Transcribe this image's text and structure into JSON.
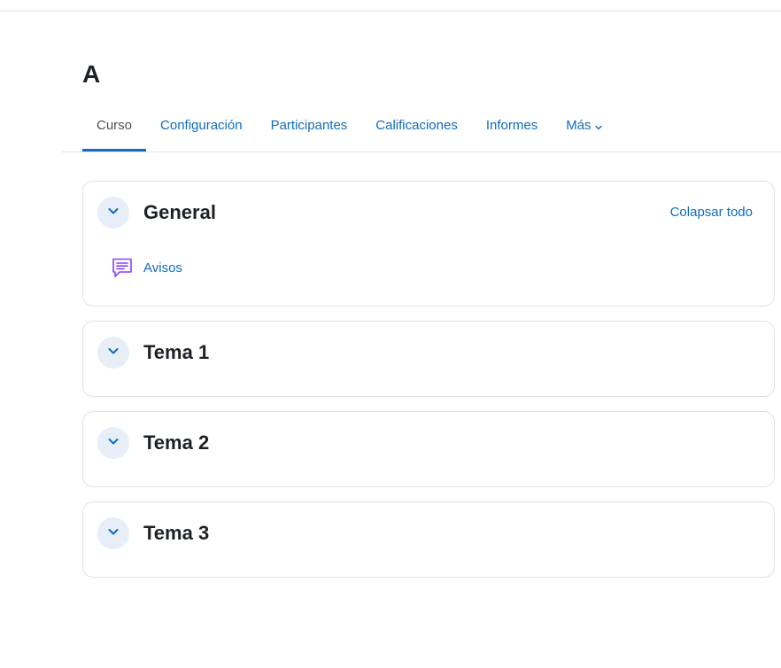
{
  "course": {
    "title": "A"
  },
  "tabs": [
    {
      "label": "Curso",
      "active": true
    },
    {
      "label": "Configuración",
      "active": false
    },
    {
      "label": "Participantes",
      "active": false
    },
    {
      "label": "Calificaciones",
      "active": false
    },
    {
      "label": "Informes",
      "active": false
    },
    {
      "label": "Más",
      "active": false
    }
  ],
  "sections": [
    {
      "title": "General",
      "collapse_all_label": "Colapsar todo",
      "activities": [
        {
          "label": "Avisos",
          "icon": "forum-icon"
        }
      ]
    },
    {
      "title": "Tema 1"
    },
    {
      "title": "Tema 2"
    },
    {
      "title": "Tema 3"
    }
  ],
  "colors": {
    "link": "#0f6cbf",
    "toggle_bg": "#e7eef7",
    "forum_icon": "#8a3ffc",
    "border": "#dee2e6"
  }
}
